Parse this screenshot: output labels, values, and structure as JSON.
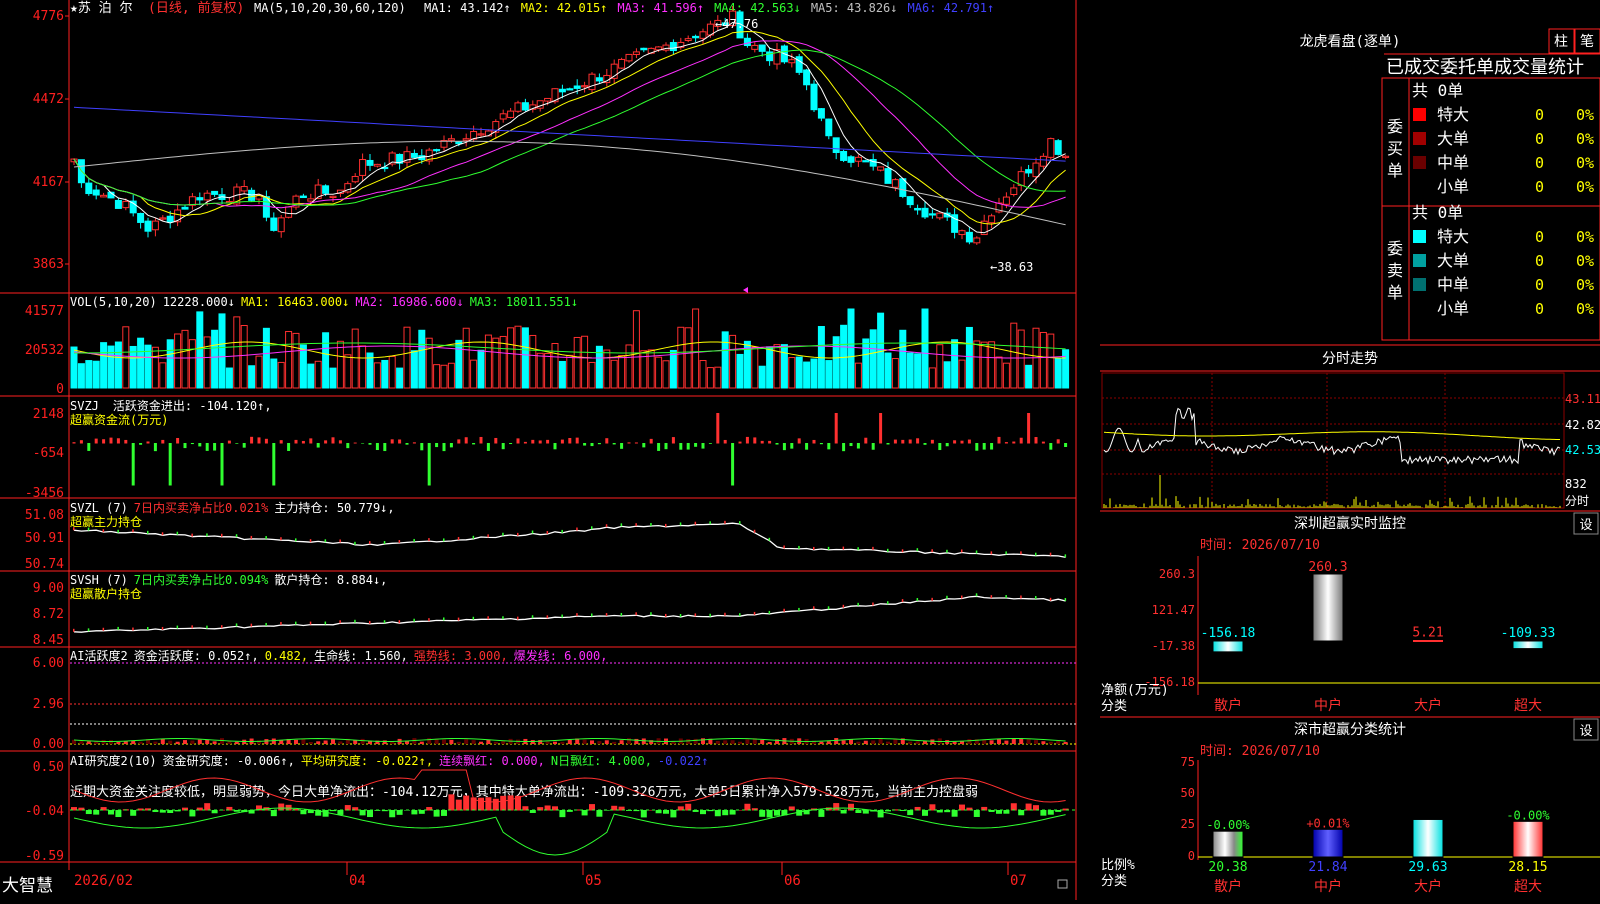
{
  "colors": {
    "up": "#ff3030",
    "down": "#00ffff",
    "axis": "#ff2020",
    "yellow": "#ffff00",
    "magenta": "#ff30ff",
    "green": "#30ff30",
    "blue": "#4040ff",
    "grey": "#c0c0c0",
    "white": "#ffffff"
  },
  "main": {
    "ticker": "★苏 泊 尔",
    "mode": "(日线, 前复权)",
    "ma_header": {
      "label": "MA(5,10,20,30,60,120)",
      "items": [
        {
          "text": "MA1: 43.142↑",
          "color": "#ffffff"
        },
        {
          "text": "MA2: 42.015↑",
          "color": "#ffff00"
        },
        {
          "text": "MA3: 41.596↑",
          "color": "#ff30ff"
        },
        {
          "text": "MA4: 42.563↓",
          "color": "#30ff30"
        },
        {
          "text": "MA5: 43.826↓",
          "color": "#c0c0c0"
        },
        {
          "text": "MA6: 42.791↑",
          "color": "#4040ff"
        }
      ]
    },
    "price_axis": [
      "4776",
      "4472",
      "4167",
      "3863"
    ],
    "annotations": {
      "high": "47.76",
      "low": "38.63"
    },
    "vol": {
      "header": "VOL(5,10,20)",
      "value": "12228.000↓",
      "ma1": "MA1: 16463.000↓",
      "ma2": "MA2: 16986.600↓",
      "ma3": "MA3: 18011.551↓",
      "axis": [
        "41577",
        "20532",
        "0"
      ]
    },
    "svzj": {
      "header": "SVZJ",
      "label": "活跃资金进出: -104.120↑,",
      "sub": "超赢资金流(万元)",
      "axis": [
        "2148",
        "-654",
        "-3456"
      ]
    },
    "svzl": {
      "header": "SVZL (7)",
      "ratio": "7日内买卖净占比0.021%",
      "hold": "主力持仓: 50.779↓,",
      "sub": "超赢主力持仓",
      "axis": [
        "51.08",
        "50.91",
        "50.74"
      ]
    },
    "svsh": {
      "header": "SVSH (7)",
      "ratio": "7日内买卖净占比0.094%",
      "hold": "散户持仓: 8.884↓,",
      "sub": "超赢散户持仓",
      "axis": [
        "9.00",
        "8.72",
        "8.45"
      ]
    },
    "ai1": {
      "header": "AI活跃度2",
      "t1": "资金活跃度: 0.052↑,",
      "t2": "0.482,",
      "t3": "生命线: 1.560,",
      "t4": "强势线: 3.000,",
      "t5": "爆发线: 6.000,",
      "axis": [
        "6.00",
        "2.96",
        "0.00"
      ]
    },
    "ai2": {
      "header": "AI研究度2(10)",
      "t1": "资金研究度: -0.006↑,",
      "t2": "平均研究度: -0.022↑,",
      "t3": "连续飘红: 0.000,",
      "t4": "N日飘红: 4.000,",
      "t5": "-0.022↑",
      "comment": "近期大资金关注度较低，明显弱势，今日大单净流出：-104.12万元，其中特大单净流出：-109.326万元，大单5日累计净入579.528万元，当前主力控盘弱",
      "axis": [
        "0.50",
        "-0.04",
        "-0.59"
      ]
    },
    "date_axis": [
      "2026/02",
      "04",
      "05",
      "06",
      "07"
    ],
    "logo": "大智慧"
  },
  "right": {
    "dragon": {
      "title": "龙虎看盘(逐单)",
      "btn_bar": "柱",
      "btn_detail": "笔",
      "subtitle": "已成交委托单成交量统计",
      "buy": {
        "side": "委买单",
        "total": "共 0单",
        "rows": [
          {
            "label": "特大",
            "count": "0",
            "pct": "0%",
            "color": "#ff0000"
          },
          {
            "label": "大单",
            "count": "0",
            "pct": "0%",
            "color": "#a00000"
          },
          {
            "label": "中单",
            "count": "0",
            "pct": "0%",
            "color": "#6a0000"
          },
          {
            "label": "小单",
            "count": "0",
            "pct": "0%",
            "color": "#000000"
          }
        ]
      },
      "sell": {
        "side": "委卖单",
        "total": "共 0单",
        "rows": [
          {
            "label": "特大",
            "count": "0",
            "pct": "0%",
            "color": "#00ffff"
          },
          {
            "label": "大单",
            "count": "0",
            "pct": "0%",
            "color": "#00a0a0"
          },
          {
            "label": "中单",
            "count": "0",
            "pct": "0%",
            "color": "#007070"
          },
          {
            "label": "小单",
            "count": "0",
            "pct": "0%",
            "color": "#000000"
          }
        ]
      }
    },
    "intraday": {
      "title": "分时走势",
      "axis_right": [
        "43.11",
        "42.82",
        "42.53"
      ],
      "volume_label": "832",
      "volume_unit": "分时"
    },
    "monitor": {
      "title": "深圳超赢实时监控",
      "settings": "设",
      "time": "时间: 2026/07/10",
      "axis": [
        "260.3",
        "121.47",
        "-17.38",
        "-156.18"
      ],
      "ylabel": "净额(万元)",
      "xlabel": "分类",
      "bars": [
        {
          "label": "散户",
          "value": "-156.18"
        },
        {
          "label": "中户",
          "value": "260.3"
        },
        {
          "label": "大户",
          "value": "5.21"
        },
        {
          "label": "超大",
          "value": "-109.33"
        }
      ]
    },
    "classify": {
      "title": "深市超赢分类统计",
      "settings": "设",
      "time": "时间: 2026/07/10",
      "axis": [
        "75",
        "50",
        "25",
        "0"
      ],
      "ylabel": "比例%",
      "xlabel": "分类",
      "bars": [
        {
          "label": "散户",
          "value": "20.38",
          "delta": "-0.00%"
        },
        {
          "label": "中户",
          "value": "21.84",
          "delta": "+0.01%"
        },
        {
          "label": "大户",
          "value": "29.63",
          "delta": ""
        },
        {
          "label": "超大",
          "value": "28.15",
          "delta": "-0.00%"
        }
      ]
    }
  }
}
